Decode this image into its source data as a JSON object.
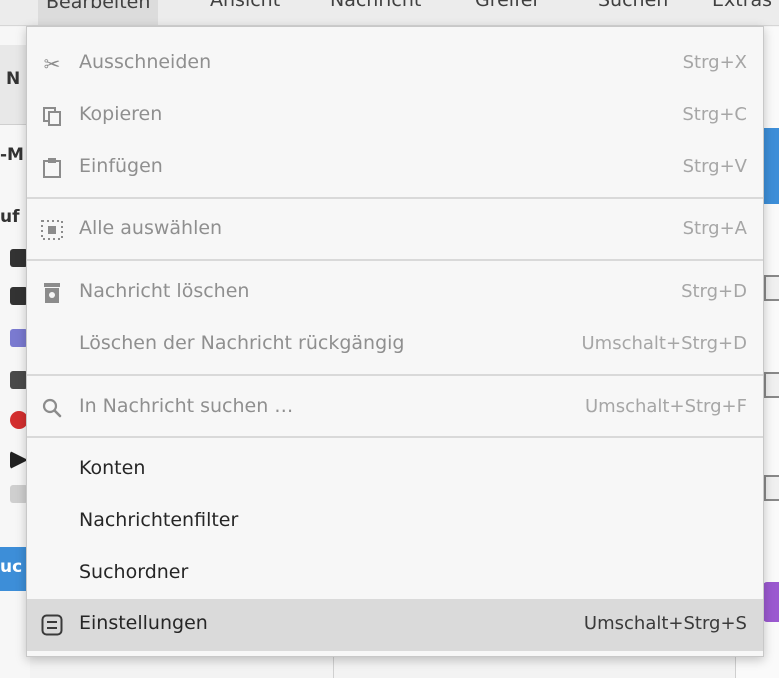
{
  "background": {
    "menubar": {
      "items": [
        "Bearbeiten",
        "Ansicht",
        "Nachricht",
        "Greifer",
        "Suchen",
        "Extras"
      ]
    },
    "left_pane": {
      "letters": [
        "N",
        "-M",
        "uf",
        "uc"
      ]
    }
  },
  "menu": {
    "groups": [
      [
        {
          "icon": "scissors-icon",
          "label": "Ausschneiden",
          "shortcut": "Strg+X",
          "enabled": false
        },
        {
          "icon": "copy-icon",
          "label": "Kopieren",
          "shortcut": "Strg+C",
          "enabled": false
        },
        {
          "icon": "clipboard-icon",
          "label": "Einfügen",
          "shortcut": "Strg+V",
          "enabled": false
        }
      ],
      [
        {
          "icon": "select-all-icon",
          "label": "Alle auswählen",
          "shortcut": "Strg+A",
          "enabled": false
        }
      ],
      [
        {
          "icon": "trash-icon",
          "label": "Nachricht löschen",
          "shortcut": "Strg+D",
          "enabled": false
        },
        {
          "icon": "",
          "label": "Löschen der Nachricht rückgängig",
          "shortcut": "Umschalt+Strg+D",
          "enabled": false
        }
      ],
      [
        {
          "icon": "search-icon",
          "label": "In Nachricht suchen …",
          "shortcut": "Umschalt+Strg+F",
          "enabled": false
        }
      ],
      [
        {
          "icon": "",
          "label": "Konten",
          "shortcut": "",
          "enabled": true
        },
        {
          "icon": "",
          "label": "Nachrichtenfilter",
          "shortcut": "",
          "enabled": true
        },
        {
          "icon": "",
          "label": "Suchordner",
          "shortcut": "",
          "enabled": true
        },
        {
          "icon": "settings-icon",
          "label": "Einstellungen",
          "shortcut": "Umschalt+Strg+S",
          "enabled": true,
          "highlighted": true
        }
      ]
    ]
  }
}
